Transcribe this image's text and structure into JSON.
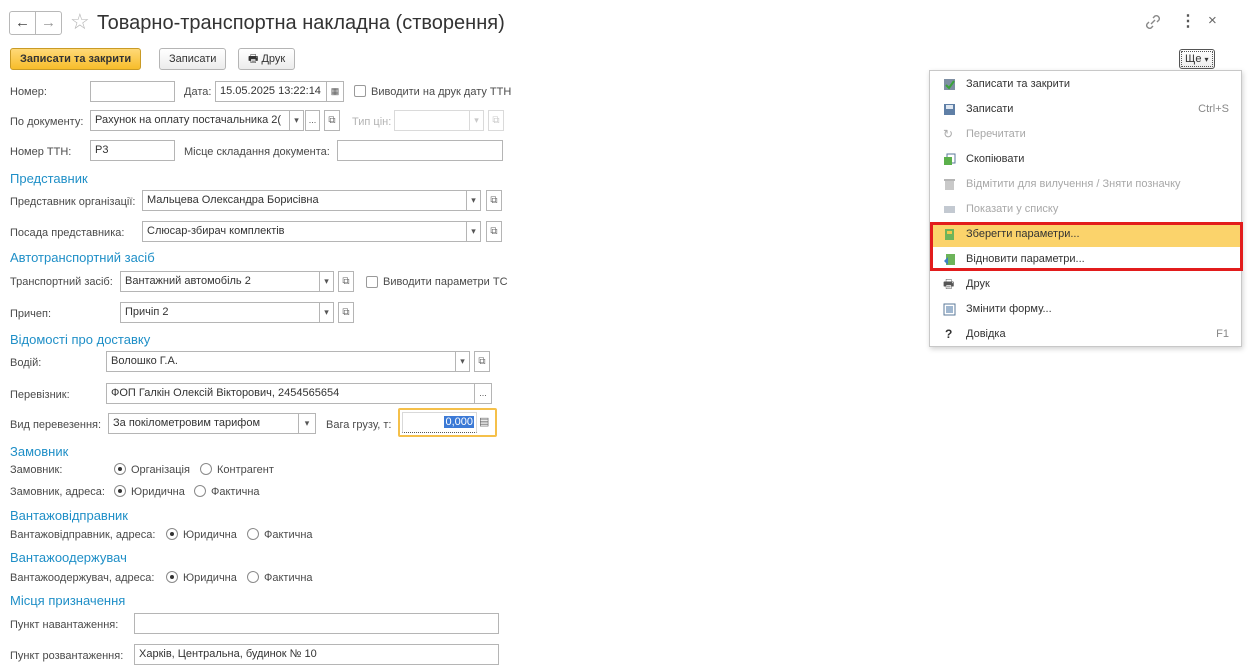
{
  "header": {
    "title": "Товарно-транспортна накладна (створення)"
  },
  "toolbar": {
    "save_close": "Записати та закрити",
    "save": "Записати",
    "print": "Друк",
    "more": "Ще"
  },
  "fields": {
    "number_label": "Номер:",
    "number_value": "",
    "date_label": "Дата:",
    "date_value": "15.05.2025 13:22:14",
    "print_date_label": "Виводити на друк дату ТТН",
    "by_doc_label": "По документу:",
    "by_doc_value": "Рахунок на оплату постачальника 2(",
    "price_type_label": "Тип цін:",
    "price_type_value": "",
    "ttn_number_label": "Номер ТТН:",
    "ttn_number_value": "Р3",
    "place_label": "Місце складання документа:",
    "place_value": ""
  },
  "representative": {
    "section": "Представник",
    "org_rep_label": "Представник організації:",
    "org_rep_value": "Мальцева Олександра Борисівна",
    "position_label": "Посада представника:",
    "position_value": "Слюсар-збирач комплектів"
  },
  "vehicle": {
    "section": "Автотранспортний засіб",
    "vehicle_label": "Транспортний засіб:",
    "vehicle_value": "Вантажний автомобіль 2",
    "print_params_label": "Виводити параметри ТС",
    "trailer_label": "Причеп:",
    "trailer_value": "Причіп 2"
  },
  "delivery": {
    "section": "Відомості про доставку",
    "driver_label": "Водій:",
    "driver_value": "Волошко Г.А.",
    "carrier_label": "Перевізник:",
    "carrier_value": "ФОП Галкін Олексій Вікторович, 2454565654",
    "transport_type_label": "Вид перевезення:",
    "transport_type_value": "За покілометровим тарифом",
    "weight_label": "Вага грузу, т:",
    "weight_value": "0,000"
  },
  "customer": {
    "section": "Замовник",
    "customer_label": "Замовник:",
    "opt_org": "Організація",
    "opt_contractor": "Контрагент",
    "address_label": "Замовник, адреса:",
    "opt_legal": "Юридична",
    "opt_actual": "Фактична"
  },
  "shipper": {
    "section": "Вантажовідправник",
    "address_label": "Вантажовідправник, адреса:",
    "opt_legal": "Юридична",
    "opt_actual": "Фактична"
  },
  "consignee": {
    "section": "Вантажоодержувач",
    "address_label": "Вантажоодержувач, адреса:",
    "opt_legal": "Юридична",
    "opt_actual": "Фактична"
  },
  "destinations": {
    "section": "Місця призначення",
    "loading_label": "Пункт навантаження:",
    "loading_value": "",
    "unloading_label": "Пункт розвантаження:",
    "unloading_value": "Харків, Центральна, будинок № 10"
  },
  "menu": {
    "items": [
      {
        "label": "Записати та закрити",
        "shortcut": "",
        "icon": "save-close-icon"
      },
      {
        "label": "Записати",
        "shortcut": "Ctrl+S",
        "icon": "floppy-icon"
      },
      {
        "label": "Перечитати",
        "shortcut": "",
        "icon": "refresh-icon"
      },
      {
        "label": "Скопіювати",
        "shortcut": "",
        "icon": "copy-icon"
      },
      {
        "label": "Відмітити для вилучення / Зняти позначку",
        "shortcut": "",
        "icon": "mark-delete-icon"
      },
      {
        "label": "Показати у списку",
        "shortcut": "",
        "icon": "list-icon"
      },
      {
        "label": "Зберегти параметри...",
        "shortcut": "",
        "icon": "save-params-icon"
      },
      {
        "label": "Відновити параметри...",
        "shortcut": "",
        "icon": "restore-params-icon"
      },
      {
        "label": "Друк",
        "shortcut": "",
        "icon": "printer-icon"
      },
      {
        "label": "Змінити форму...",
        "shortcut": "",
        "icon": "form-icon"
      },
      {
        "label": "Довідка",
        "shortcut": "F1",
        "icon": "help-icon"
      }
    ]
  },
  "colors": {
    "accent": "#1f8fc7",
    "primary_button": "#f7bd2a",
    "highlight": "#fbd36b",
    "annotation": "#e21c1c"
  }
}
